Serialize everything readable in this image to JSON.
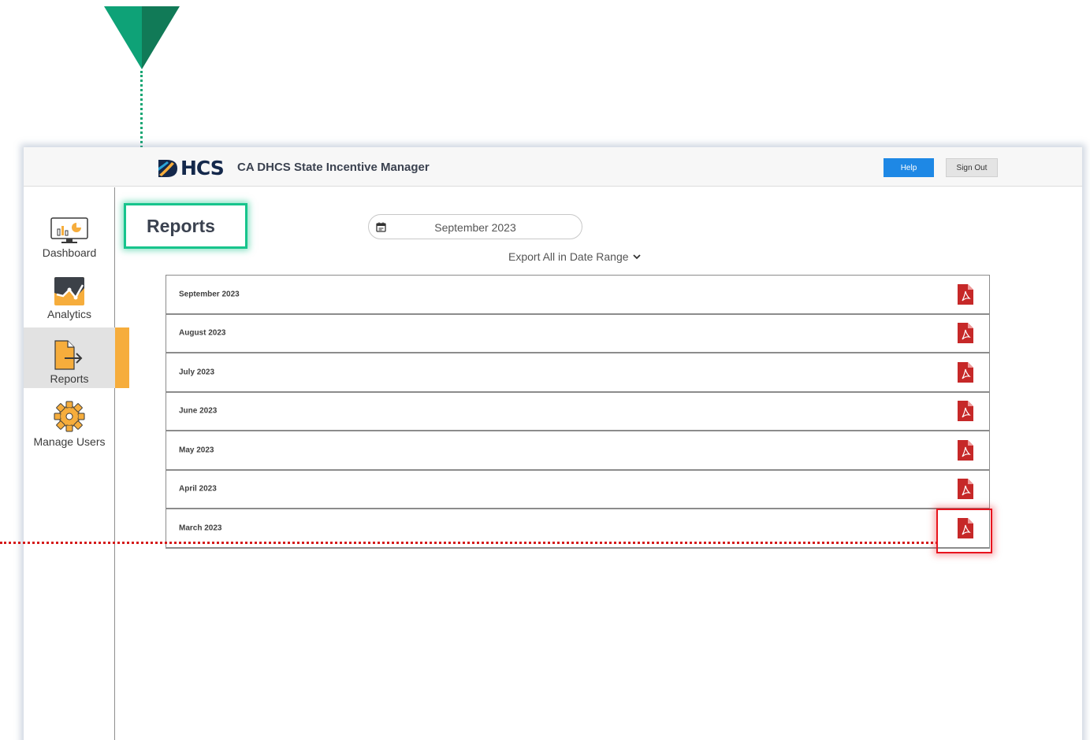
{
  "header": {
    "logo_text": "HCS",
    "app_title": "CA DHCS State Incentive Manager",
    "help_label": "Help",
    "signout_label": "Sign Out"
  },
  "sidebar": {
    "items": [
      {
        "label": "Dashboard",
        "icon": "dashboard-monitor-icon"
      },
      {
        "label": "Analytics",
        "icon": "analytics-chart-icon"
      },
      {
        "label": "Reports",
        "icon": "reports-export-icon",
        "active": true
      },
      {
        "label": "Manage Users",
        "icon": "gear-users-icon"
      }
    ]
  },
  "main": {
    "page_title": "Reports",
    "date_picker_value": "September 2023",
    "export_label": "Export All in Date Range",
    "reports": [
      {
        "label": "September 2023"
      },
      {
        "label": "August 2023"
      },
      {
        "label": "July 2023"
      },
      {
        "label": "June 2023"
      },
      {
        "label": "May 2023"
      },
      {
        "label": "April 2023"
      },
      {
        "label": "March 2023"
      }
    ]
  },
  "colors": {
    "accent_orange": "#f6ad3c",
    "help_blue": "#1e88e5",
    "pdf_red": "#c62828",
    "annotation_green": "#17c48c",
    "annotation_red": "#e8141e"
  }
}
